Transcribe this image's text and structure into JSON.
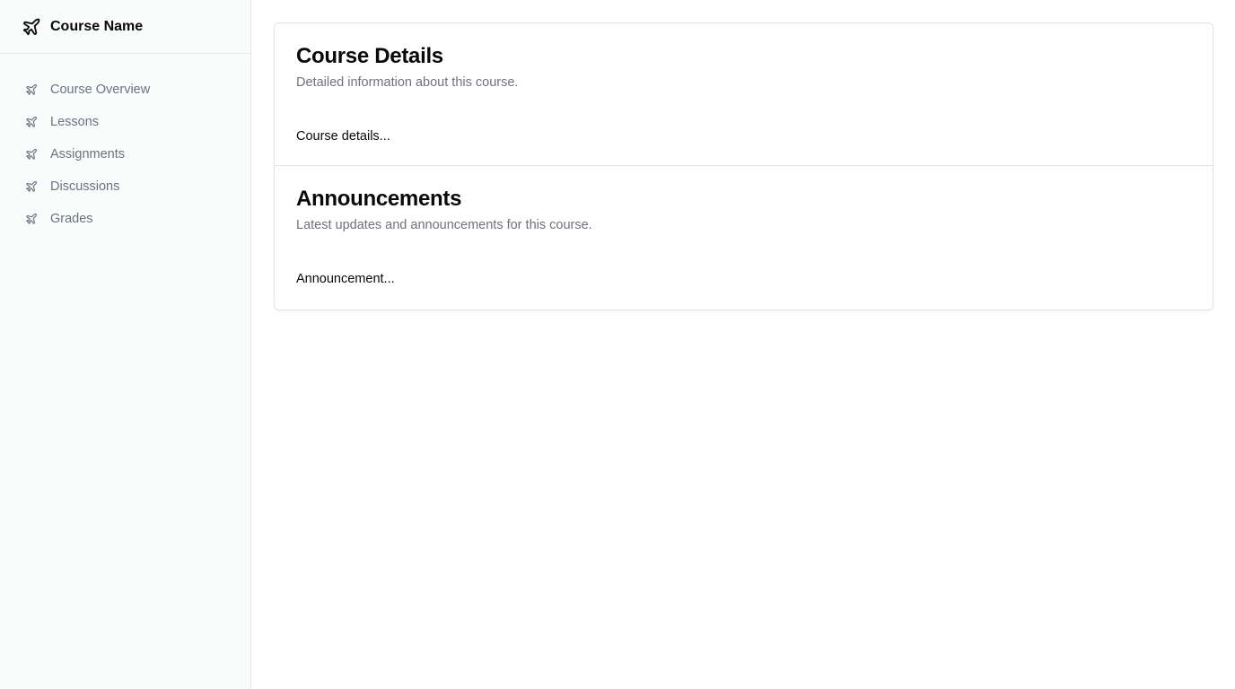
{
  "sidebar": {
    "brand": {
      "title": "Course Name",
      "icon": "plane-icon"
    },
    "items": [
      {
        "label": "Course Overview",
        "icon": "plane-icon"
      },
      {
        "label": "Lessons",
        "icon": "plane-icon"
      },
      {
        "label": "Assignments",
        "icon": "plane-icon"
      },
      {
        "label": "Discussions",
        "icon": "plane-icon"
      },
      {
        "label": "Grades",
        "icon": "plane-icon"
      }
    ]
  },
  "main": {
    "cards": [
      {
        "title": "Course Details",
        "description": "Detailed information about this course.",
        "body": "Course details..."
      },
      {
        "title": "Announcements",
        "description": "Latest updates and announcements for this course.",
        "body": "Announcement..."
      }
    ]
  },
  "colors": {
    "sidebar_bg": "#fafbfb",
    "border": "#e5e7eb",
    "muted_text": "#6b7280",
    "heading_text": "#09090b"
  }
}
